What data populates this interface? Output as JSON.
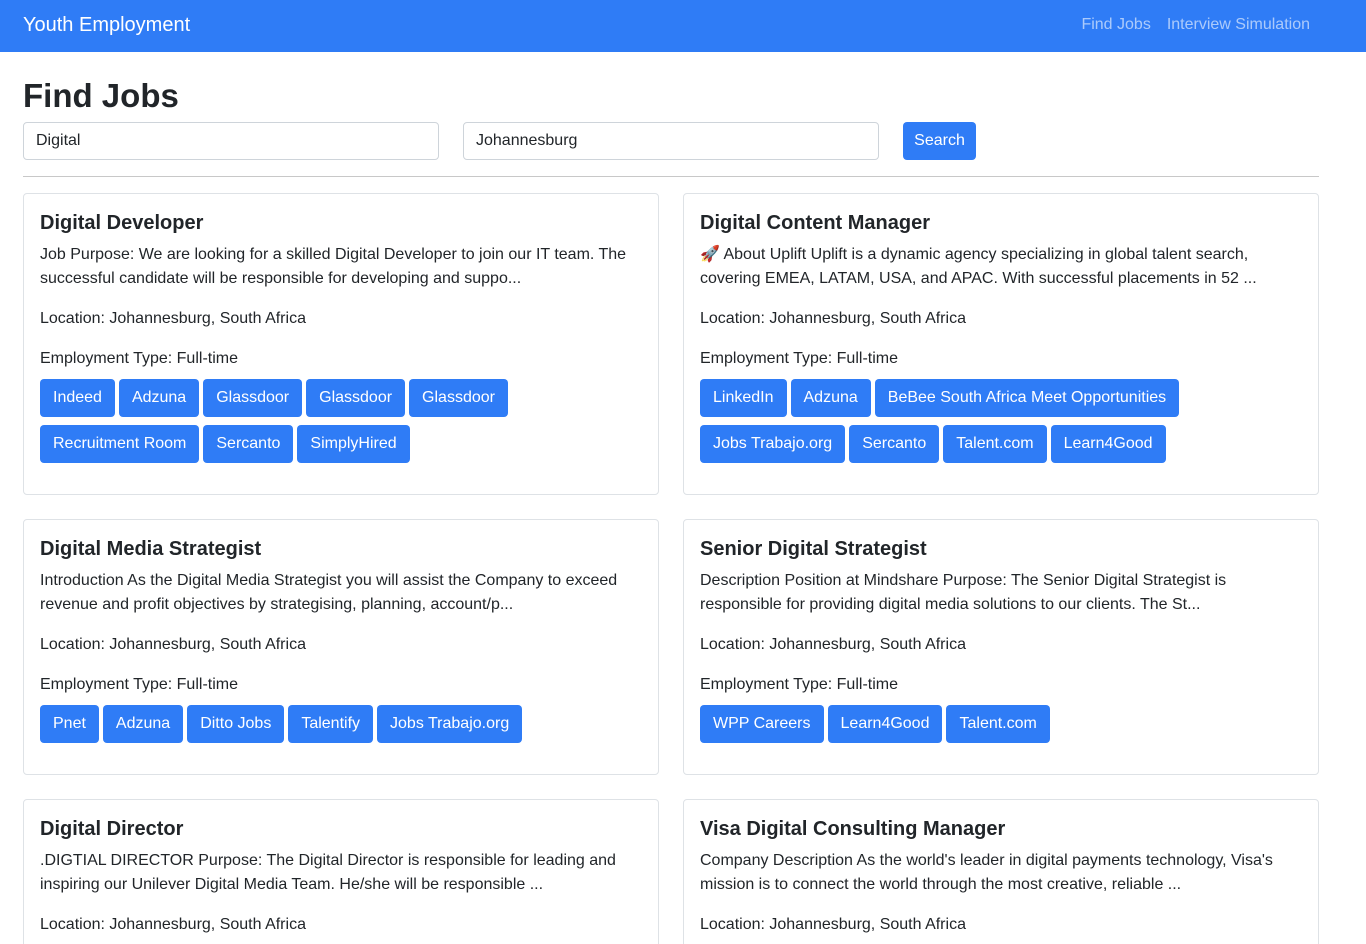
{
  "nav": {
    "brand": "Youth Employment",
    "links": [
      "Find Jobs",
      "Interview Simulation"
    ]
  },
  "page": {
    "title": "Find Jobs"
  },
  "search": {
    "keyword": "Digital",
    "location": "Johannesburg",
    "button": "Search"
  },
  "colors": {
    "primary": "#2f7cf6",
    "nav_link": "rgba(255,255,255,0.6)",
    "text": "#212529",
    "border": "#dee2e6"
  },
  "jobs": [
    {
      "title": "Digital Developer",
      "description": "Job Purpose: We are looking for a skilled Digital Developer to join our IT team. The successful candidate will be responsible for developing and suppo...",
      "location": "Location: Johannesburg, South Africa",
      "employment_type": "Employment Type: Full-time",
      "sources": [
        "Indeed",
        "Adzuna",
        "Glassdoor",
        "Glassdoor",
        "Glassdoor",
        "Recruitment Room",
        "Sercanto",
        "SimplyHired"
      ]
    },
    {
      "title": "Digital Content Manager",
      "description": "🚀 About Uplift Uplift is a dynamic agency specializing in global talent search, covering EMEA, LATAM, USA, and APAC. With successful placements in 52 ...",
      "location": "Location: Johannesburg, South Africa",
      "employment_type": "Employment Type: Full-time",
      "sources": [
        "LinkedIn",
        "Adzuna",
        "BeBee South Africa Meet Opportunities",
        "Jobs Trabajo.org",
        "Sercanto",
        "Talent.com",
        "Learn4Good"
      ]
    },
    {
      "title": "Digital Media Strategist",
      "description": "Introduction As the Digital Media Strategist you will assist the Company to exceed revenue and profit objectives by strategising, planning, account/p...",
      "location": "Location: Johannesburg, South Africa",
      "employment_type": "Employment Type: Full-time",
      "sources": [
        "Pnet",
        "Adzuna",
        "Ditto Jobs",
        "Talentify",
        "Jobs Trabajo.org"
      ]
    },
    {
      "title": "Senior Digital Strategist",
      "description": "Description Position at Mindshare Purpose: The Senior Digital Strategist is responsible for providing digital media solutions to our clients. The St...",
      "location": "Location: Johannesburg, South Africa",
      "employment_type": "Employment Type: Full-time",
      "sources": [
        "WPP Careers",
        "Learn4Good",
        "Talent.com"
      ]
    },
    {
      "title": "Digital Director",
      "description": ".DIGTIAL DIRECTOR Purpose: The Digital Director is responsible for leading and inspiring our Unilever Digital Media Team. He/she will be responsible ...",
      "location": "Location: Johannesburg, South Africa",
      "employment_type": "",
      "sources": []
    },
    {
      "title": "Visa Digital Consulting Manager",
      "description": "Company Description As the world's leader in digital payments technology, Visa's mission is to connect the world through the most creative, reliable ...",
      "location": "Location: Johannesburg, South Africa",
      "employment_type": "",
      "sources": []
    }
  ]
}
